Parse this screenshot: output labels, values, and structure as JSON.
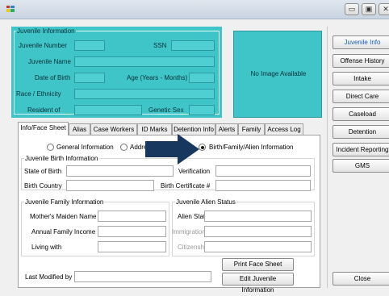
{
  "window": {
    "minimize_glyph": "▭",
    "maximize_glyph": "▣",
    "close_glyph": "✕"
  },
  "juvenile_info": {
    "legend": "Juvenile Information",
    "labels": {
      "juvenile_number": "Juvenile Number",
      "ssn": "SSN",
      "juvenile_name": "Juvenile Name",
      "date_of_birth": "Date of Birth",
      "age": "Age (Years - Months)",
      "race": "Race / Ethnicity",
      "resident_of": "Resident of",
      "genetic_sex": "Genetic Sex"
    },
    "image_placeholder": "No Image Available"
  },
  "tabs": [
    {
      "label": "Info/Face Sheet"
    },
    {
      "label": "Alias"
    },
    {
      "label": "Case Workers"
    },
    {
      "label": "ID Marks"
    },
    {
      "label": "Detention Info"
    },
    {
      "label": "Alerts"
    },
    {
      "label": "Family"
    },
    {
      "label": "Access Log"
    }
  ],
  "radios": {
    "general": "General Information",
    "address": "Address",
    "birth": "Birth/Family/Alien Information"
  },
  "birth_info": {
    "legend": "Juvenile Birth Information",
    "state_of_birth": "State of Birth",
    "birth_country": "Birth Country",
    "verification": "Verification",
    "birth_certificate": "Birth Certificate #"
  },
  "family_info": {
    "legend": "Juvenile Family Information",
    "mothers_maiden_name": "Mother's Maiden Name",
    "annual_family_income": "Annual Family Income",
    "living_with": "Living with"
  },
  "alien_status": {
    "legend": "Juvenile Alien Status",
    "alien_status": "Alien Status",
    "immigration": "Immigration #",
    "citizenship": "Citizenship"
  },
  "bottom": {
    "last_modified_by": "Last Modified by",
    "print_face_sheet": "Print Face Sheet",
    "edit_juvenile_info": "Edit Juvenile Information"
  },
  "sidebar": {
    "items": [
      {
        "label": "Juvenile Info"
      },
      {
        "label": "Offense History"
      },
      {
        "label": "Intake"
      },
      {
        "label": "Direct Care"
      },
      {
        "label": "Caseload"
      },
      {
        "label": "Detention"
      },
      {
        "label": "Incident Reporting"
      },
      {
        "label": "GMS"
      }
    ],
    "close_label": "Close"
  },
  "colors": {
    "panel_cyan": "#3fc5c7",
    "arrow": "#17375e",
    "active_sidebar_text": "#1a5db8"
  }
}
